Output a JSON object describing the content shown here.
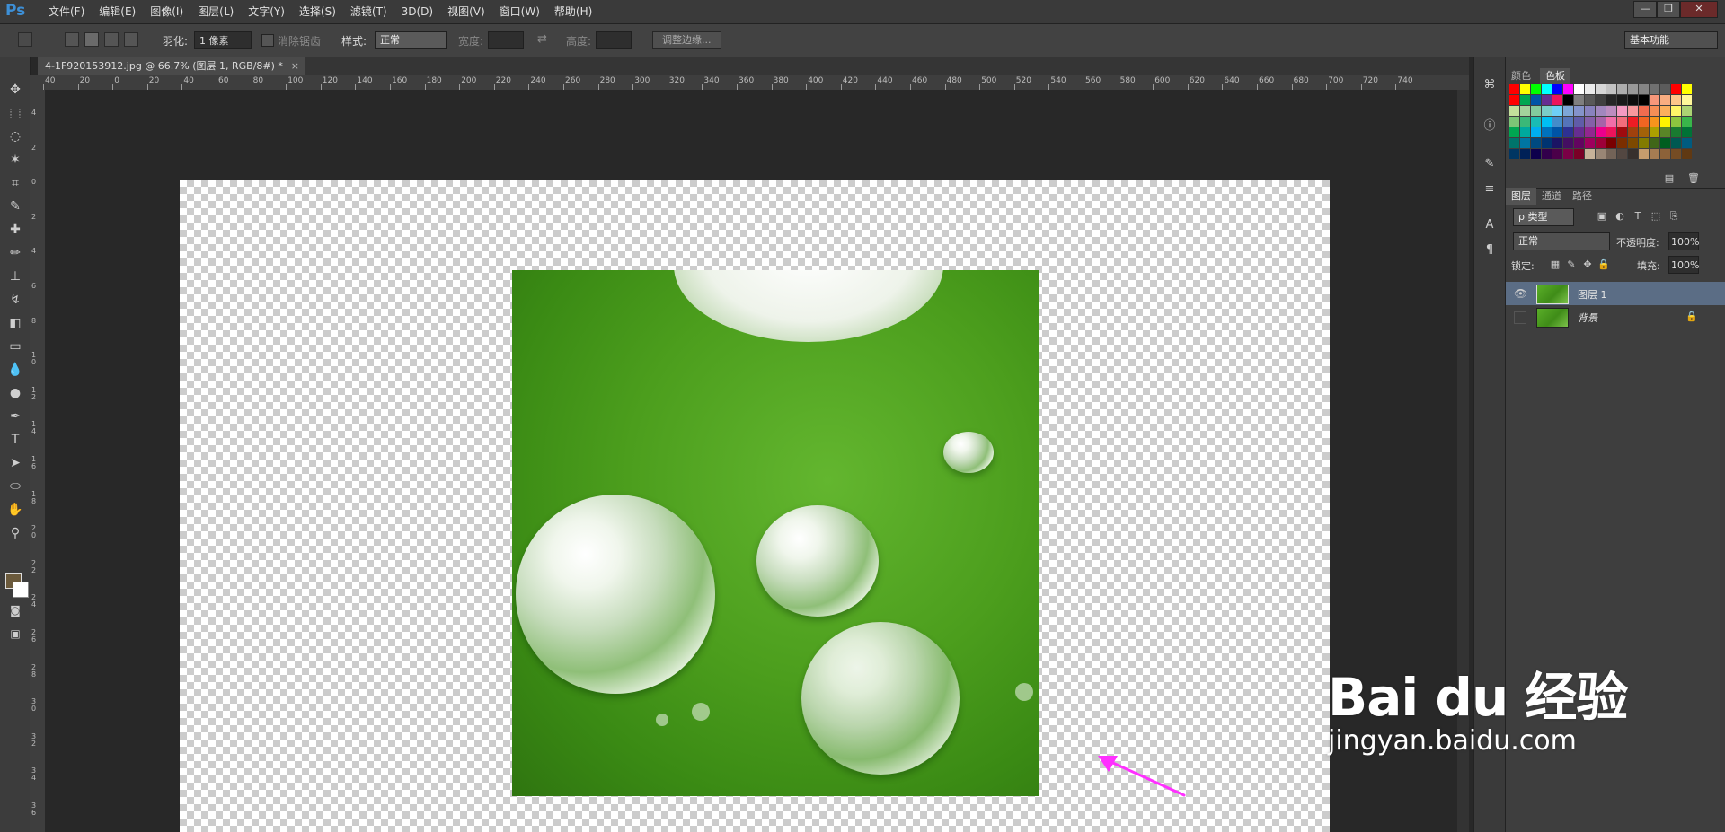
{
  "app": {
    "logo": "Ps"
  },
  "menu": [
    "文件(F)",
    "编辑(E)",
    "图像(I)",
    "图层(L)",
    "文字(Y)",
    "选择(S)",
    "滤镜(T)",
    "3D(D)",
    "视图(V)",
    "窗口(W)",
    "帮助(H)"
  ],
  "window_controls": {
    "minimize": "—",
    "restore": "❐",
    "close": "✕"
  },
  "options": {
    "feather_label": "羽化:",
    "feather_value": "1 像素",
    "antialias_label": "消除锯齿",
    "style_label": "样式:",
    "style_value": "正常",
    "width_label": "宽度:",
    "height_label": "高度:",
    "refine_edge": "调整边缘...",
    "workspace": "基本功能"
  },
  "document": {
    "tab_title": "4-1F920153912.jpg @ 66.7% (图层 1, RGB/8#) *",
    "close": "×"
  },
  "ruler_top_labels": [
    "40",
    "20",
    "0",
    "20",
    "40",
    "60",
    "80",
    "100",
    "120",
    "140",
    "160",
    "180",
    "200",
    "220",
    "240",
    "260",
    "280",
    "300",
    "320",
    "340",
    "360",
    "380",
    "400",
    "420",
    "440",
    "460",
    "480",
    "500",
    "520",
    "540",
    "560",
    "580",
    "600",
    "620",
    "640",
    "660",
    "680",
    "700",
    "720",
    "740"
  ],
  "ruler_left_labels": [
    "4",
    "2",
    "0",
    "2",
    "4",
    "6",
    "8",
    "1 0",
    "1 2",
    "1 4",
    "1 6",
    "1 8",
    "2 0",
    "2 2",
    "2 4",
    "2 6",
    "2 8",
    "3 0",
    "3 2",
    "3 4",
    "3 6"
  ],
  "panels": {
    "color_tabs": [
      "颜色",
      "色板"
    ],
    "layer_tabs": [
      "图层",
      "通道",
      "路径"
    ],
    "filter_kind": "ρ 类型",
    "blend_mode": "正常",
    "opacity_label": "不透明度:",
    "opacity_value": "100%",
    "lock_label": "锁定:",
    "fill_label": "填充:",
    "fill_value": "100%",
    "layers": [
      {
        "name": "图层 1",
        "visible": true,
        "selected": true
      },
      {
        "name": "背景",
        "visible": false,
        "selected": false,
        "locked": true
      }
    ]
  },
  "watermark": {
    "main": "Bai du 经验",
    "sub": "jingyan.baidu.com"
  },
  "colors": {
    "accent": "#3d8fd6",
    "arrow": "#ff30ff",
    "selected_layer": "#5b6d85"
  }
}
